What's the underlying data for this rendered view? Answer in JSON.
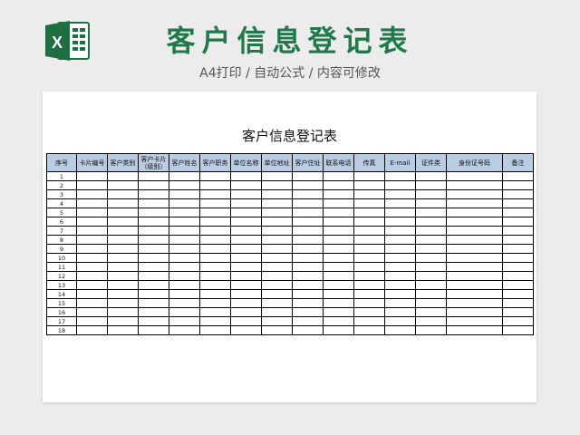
{
  "colors": {
    "brand_green": "#1f7a4a",
    "header_blue": "#b8cce4",
    "excel_green": "#1d6f42"
  },
  "banner": {
    "icon": "excel-icon",
    "title": "客户信息登记表",
    "subtitle": "A4打印 / 自动公式 / 内容可修改"
  },
  "sheet": {
    "title": "客户信息登记表",
    "columns": [
      "序号",
      "卡片编号",
      "客户类别",
      "客户卡片（级别）",
      "客户姓名",
      "客户职务",
      "单位名称",
      "单位地址",
      "客户住址",
      "联系电话",
      "传真",
      "E-mail",
      "证件类",
      "身份证号码",
      "备注"
    ],
    "row_numbers": [
      "1",
      "2",
      "3",
      "4",
      "5",
      "6",
      "7",
      "8",
      "9",
      "10",
      "11",
      "12",
      "13",
      "14",
      "15",
      "16",
      "17",
      "18"
    ]
  }
}
